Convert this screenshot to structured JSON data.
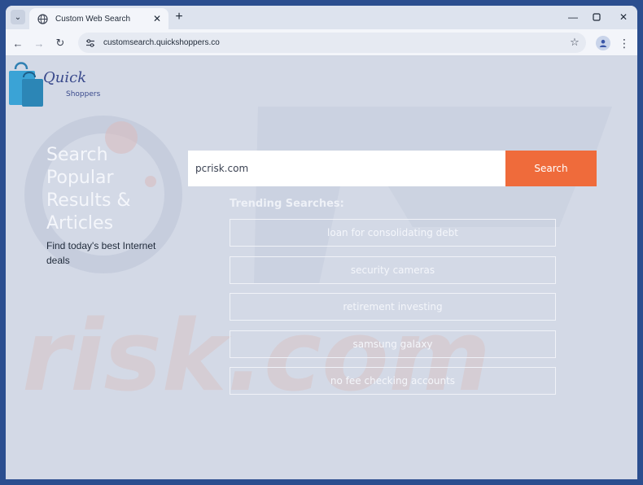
{
  "browser": {
    "tab_title": "Custom Web Search",
    "url": "customsearch.quickshoppers.co",
    "icons": [
      "tab-search-icon",
      "globe-icon",
      "close-icon",
      "plus-icon",
      "minimize-icon",
      "maximize-icon",
      "back-icon",
      "forward-icon",
      "reload-icon",
      "site-settings-icon",
      "star-icon",
      "profile-icon",
      "more-icon"
    ]
  },
  "logo": {
    "line1": "Quick",
    "line2": "Shoppers"
  },
  "hero": {
    "title": "Search Popular Results & Articles",
    "subtitle": "Find today's best Internet deals"
  },
  "search": {
    "value": "pcrisk.com",
    "button_label": "Search"
  },
  "trending": {
    "title": "Trending Searches:",
    "items": [
      "loan for consolidating debt",
      "security cameras",
      "retirement investing",
      "samsung galaxy",
      "no fee checking accounts"
    ]
  },
  "colors": {
    "accent": "#ef6b3b",
    "page_bg": "#d3d9e6",
    "frame": "#2b4e8f"
  }
}
